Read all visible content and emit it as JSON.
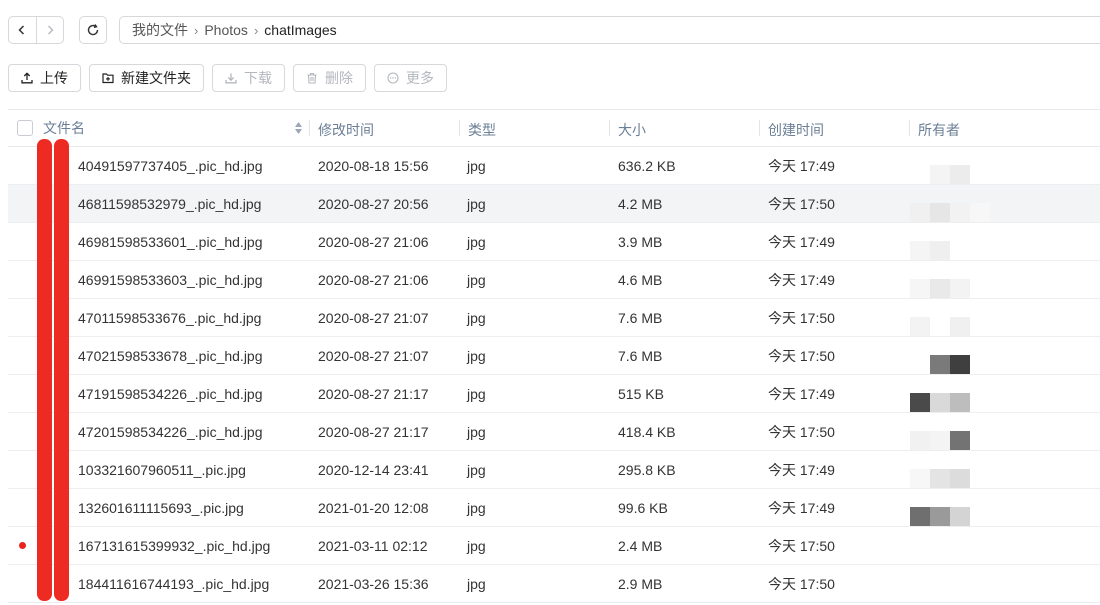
{
  "breadcrumb": {
    "items": [
      "我的文件",
      "Photos"
    ],
    "current": "chatImages",
    "separator": "›"
  },
  "toolbar": {
    "upload": "上传",
    "new_folder": "新建文件夹",
    "download": "下载",
    "delete": "删除",
    "more": "更多"
  },
  "table": {
    "headers": {
      "name": "文件名",
      "modified": "修改时间",
      "type": "类型",
      "size": "大小",
      "created": "创建时间",
      "owner": "所有者"
    },
    "rows": [
      {
        "name": "40491597737405_.pic_hd.jpg",
        "modified": "2020-08-18 15:56",
        "type": "jpg",
        "size": "636.2 KB",
        "created": "今天 17:49"
      },
      {
        "name": "46811598532979_.pic_hd.jpg",
        "modified": "2020-08-27 20:56",
        "type": "jpg",
        "size": "4.2 MB",
        "created": "今天 17:50"
      },
      {
        "name": "46981598533601_.pic_hd.jpg",
        "modified": "2020-08-27 21:06",
        "type": "jpg",
        "size": "3.9 MB",
        "created": "今天 17:49"
      },
      {
        "name": "46991598533603_.pic_hd.jpg",
        "modified": "2020-08-27 21:06",
        "type": "jpg",
        "size": "4.6 MB",
        "created": "今天 17:49"
      },
      {
        "name": "47011598533676_.pic_hd.jpg",
        "modified": "2020-08-27 21:07",
        "type": "jpg",
        "size": "7.6 MB",
        "created": "今天 17:50"
      },
      {
        "name": "47021598533678_.pic_hd.jpg",
        "modified": "2020-08-27 21:07",
        "type": "jpg",
        "size": "7.6 MB",
        "created": "今天 17:50"
      },
      {
        "name": "47191598534226_.pic_hd.jpg",
        "modified": "2020-08-27 21:17",
        "type": "jpg",
        "size": "515 KB",
        "created": "今天 17:49"
      },
      {
        "name": "47201598534226_.pic_hd.jpg",
        "modified": "2020-08-27 21:17",
        "type": "jpg",
        "size": "418.4 KB",
        "created": "今天 17:50"
      },
      {
        "name": "103321607960511_.pic.jpg",
        "modified": "2020-12-14 23:41",
        "type": "jpg",
        "size": "295.8 KB",
        "created": "今天 17:49"
      },
      {
        "name": "132601611115693_.pic.jpg",
        "modified": "2021-01-20 12:08",
        "type": "jpg",
        "size": "99.6 KB",
        "created": "今天 17:49"
      },
      {
        "name": "167131615399932_.pic_hd.jpg",
        "modified": "2021-03-11 02:12",
        "type": "jpg",
        "size": "2.4 MB",
        "created": "今天 17:50"
      },
      {
        "name": "184411616744193_.pic_hd.jpg",
        "modified": "2021-03-26 15:36",
        "type": "jpg",
        "size": "2.9 MB",
        "created": "今天 17:50"
      }
    ]
  },
  "colors": {
    "redaction": "#ee2b22",
    "header_text": "#6b7f96",
    "row_highlight": "#f3f4f6"
  },
  "icons": [
    "chevron-left-icon",
    "chevron-right-icon",
    "refresh-icon",
    "upload-icon",
    "folder-plus-icon",
    "download-icon",
    "trash-icon",
    "more-icon",
    "sort-icon"
  ]
}
